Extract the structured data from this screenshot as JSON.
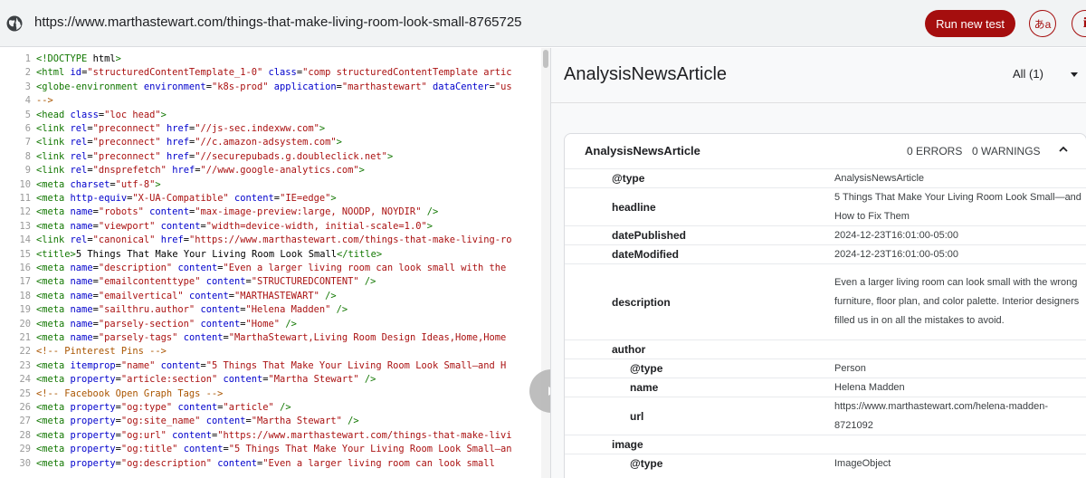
{
  "browser": {
    "url": "https://www.marthastewart.com/things-that-make-living-room-look-small-8765725",
    "run_label": "Run new test",
    "lang_label": "あa",
    "info_label": "i",
    "icons": {
      "globe": "globe-icon",
      "play": "play-icon"
    },
    "accent": "#a50e0e"
  },
  "code": {
    "lines": [
      {
        "n": "1",
        "t": "<!DOCTYPE html>"
      },
      {
        "n": "2",
        "t": "<html id=\"structuredContentTemplate_1-0\" class=\"comp structuredContentTemplate artic"
      },
      {
        "n": "3",
        "t": "<globe-environment environment=\"k8s-prod\" application=\"marthastewart\" dataCenter=\"us"
      },
      {
        "n": "4",
        "t": "-->"
      },
      {
        "n": "5",
        "t": "<head class=\"loc head\">"
      },
      {
        "n": "6",
        "t": "<link rel=\"preconnect\" href=\"//js-sec.indexww.com\">"
      },
      {
        "n": "7",
        "t": "<link rel=\"preconnect\" href=\"//c.amazon-adsystem.com\">"
      },
      {
        "n": "8",
        "t": "<link rel=\"preconnect\" href=\"//securepubads.g.doubleclick.net\">"
      },
      {
        "n": "9",
        "t": "<link rel=\"dnsprefetch\" href=\"//www.google-analytics.com\">"
      },
      {
        "n": "10",
        "t": "<meta charset=\"utf-8\">"
      },
      {
        "n": "11",
        "t": "<meta http-equiv=\"X-UA-Compatible\" content=\"IE=edge\">"
      },
      {
        "n": "12",
        "t": "<meta name=\"robots\" content=\"max-image-preview:large, NOODP, NOYDIR\" />"
      },
      {
        "n": "13",
        "t": "<meta name=\"viewport\" content=\"width=device-width, initial-scale=1.0\">"
      },
      {
        "n": "14",
        "t": "<link rel=\"canonical\" href=\"https://www.marthastewart.com/things-that-make-living-ro"
      },
      {
        "n": "15",
        "t": "<title>5 Things That Make Your Living Room Look Small</title>"
      },
      {
        "n": "16",
        "t": "<meta name=\"description\" content=\"Even a larger living room can look small with the"
      },
      {
        "n": "17",
        "t": "<meta name=\"emailcontenttype\" content=\"STRUCTUREDCONTENT\" />"
      },
      {
        "n": "18",
        "t": "<meta name=\"emailvertical\" content=\"MARTHASTEWART\" />"
      },
      {
        "n": "19",
        "t": "<meta name=\"sailthru.author\" content=\"Helena Madden\" />"
      },
      {
        "n": "20",
        "t": "<meta name=\"parsely-section\" content=\"Home\" />"
      },
      {
        "n": "21",
        "t": "<meta name=\"parsely-tags\" content=\"MarthaStewart,Living Room Design Ideas,Home,Home"
      },
      {
        "n": "22",
        "t": "<!-- Pinterest Pins -->"
      },
      {
        "n": "23",
        "t": "<meta itemprop=\"name\" content=\"5 Things That Make Your Living Room Look Small—and H"
      },
      {
        "n": "24",
        "t": "<meta property=\"article:section\" content=\"Martha Stewart\" />"
      },
      {
        "n": "25",
        "t": "<!-- Facebook Open Graph Tags -->"
      },
      {
        "n": "26",
        "t": "<meta property=\"og:type\" content=\"article\" />"
      },
      {
        "n": "27",
        "t": "<meta property=\"og:site_name\" content=\"Martha Stewart\" />"
      },
      {
        "n": "28",
        "t": "<meta property=\"og:url\" content=\"https://www.marthastewart.com/things-that-make-livi"
      },
      {
        "n": "29",
        "t": "<meta property=\"og:title\" content=\"5 Things That Make Your Living Room Look Small—an"
      },
      {
        "n": "30",
        "t": "<meta property=\"og:description\" content=\"Even a larger living room can look small"
      }
    ]
  },
  "results": {
    "title": "AnalysisNewsArticle",
    "filter": "All (1)",
    "card": {
      "title": "AnalysisNewsArticle",
      "errors": "0 ERRORS",
      "warnings": "0 WARNINGS",
      "rows": [
        {
          "key": "@type",
          "value": "AnalysisNewsArticle",
          "indent": 1
        },
        {
          "key": "headline",
          "value": "5 Things That Make Your Living Room Look Small—and How to Fix Them",
          "indent": 1
        },
        {
          "key": "datePublished",
          "value": "2024-12-23T16:01:00-05:00",
          "indent": 1
        },
        {
          "key": "dateModified",
          "value": "2024-12-23T16:01:00-05:00",
          "indent": 1
        },
        {
          "key": "description",
          "value": "Even a larger living room can look small with the wrong furniture, floor plan, and color palette. Interior designers filled us in on all the mistakes to avoid.",
          "indent": 1
        },
        {
          "key": "author",
          "value": "",
          "indent": 1
        },
        {
          "key": "@type",
          "value": "Person",
          "indent": 2
        },
        {
          "key": "name",
          "value": "Helena Madden",
          "indent": 2
        },
        {
          "key": "url",
          "value": "https://www.marthastewart.com/helena-madden-8721092",
          "indent": 2
        },
        {
          "key": "image",
          "value": "",
          "indent": 1
        },
        {
          "key": "@type",
          "value": "ImageObject",
          "indent": 2
        }
      ]
    }
  }
}
